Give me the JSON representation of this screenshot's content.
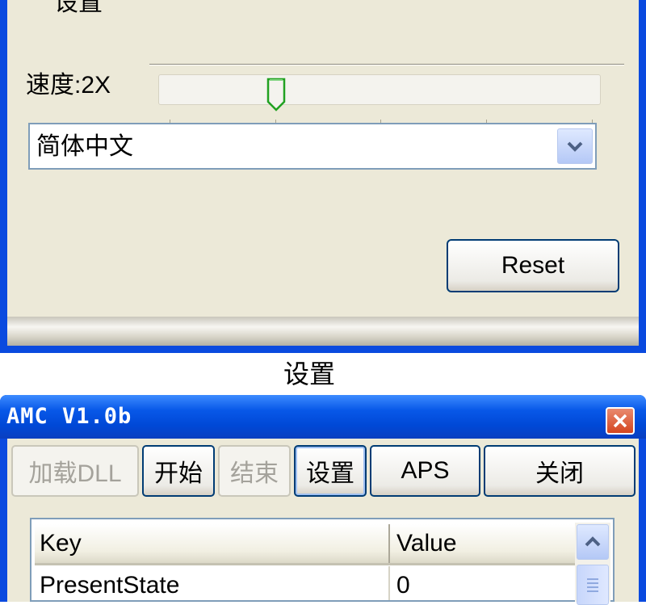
{
  "settings_window": {
    "section_title": "设置",
    "speed_label": "速度:2X",
    "language_select": {
      "selected": "简体中文"
    },
    "reset_label": "Reset"
  },
  "caption": "设置",
  "main_window": {
    "title": "AMC V1.0b",
    "toolbar": [
      {
        "label": "加载DLL",
        "enabled": false
      },
      {
        "label": "开始",
        "enabled": true
      },
      {
        "label": "结束",
        "enabled": false
      },
      {
        "label": "设置",
        "enabled": true
      },
      {
        "label": "APS",
        "enabled": true
      },
      {
        "label": "关闭",
        "enabled": true
      }
    ],
    "table": {
      "columns": [
        "Key",
        "Value"
      ],
      "rows": [
        {
          "key": "PresentState",
          "value": "0"
        }
      ]
    }
  },
  "icons": {
    "dropdown": "chevron-down-icon",
    "close": "close-x-icon",
    "scroll_up": "scroll-up-arrow-icon",
    "scroll_grip": "scroll-grip-icon",
    "slider_thumb": "slider-pointer-icon"
  },
  "colors": {
    "title_bar_blue": "#0a4adf",
    "client_beige": "#ece9d8",
    "button_border": "#003c74",
    "close_red": "#d5451f",
    "slider_thumb_green": "#21a121"
  }
}
